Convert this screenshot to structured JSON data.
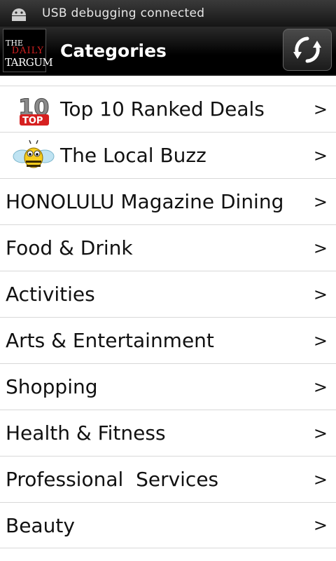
{
  "status_bar": {
    "text": "USB debugging connected",
    "icon": "android-debug-icon"
  },
  "header": {
    "logo_lines": [
      "THE",
      "DAILY",
      "TARGUM"
    ],
    "title": "Categories",
    "refresh_icon": "refresh-icon"
  },
  "categories": [
    {
      "label": "Top 10 Ranked Deals",
      "icon": "top10-icon",
      "chevron": ">"
    },
    {
      "label": "The Local Buzz",
      "icon": "bee-icon",
      "chevron": ">"
    },
    {
      "label": "HONOLULU Magazine Dining",
      "chevron": ">"
    },
    {
      "label": "Food & Drink",
      "chevron": ">"
    },
    {
      "label": "Activities",
      "chevron": ">"
    },
    {
      "label": "Arts & Entertainment",
      "chevron": ">"
    },
    {
      "label": "Shopping",
      "chevron": ">"
    },
    {
      "label": "Health & Fitness",
      "chevron": ">"
    },
    {
      "label": "Professional  Services",
      "chevron": ">"
    },
    {
      "label": "Beauty",
      "chevron": ">"
    }
  ]
}
